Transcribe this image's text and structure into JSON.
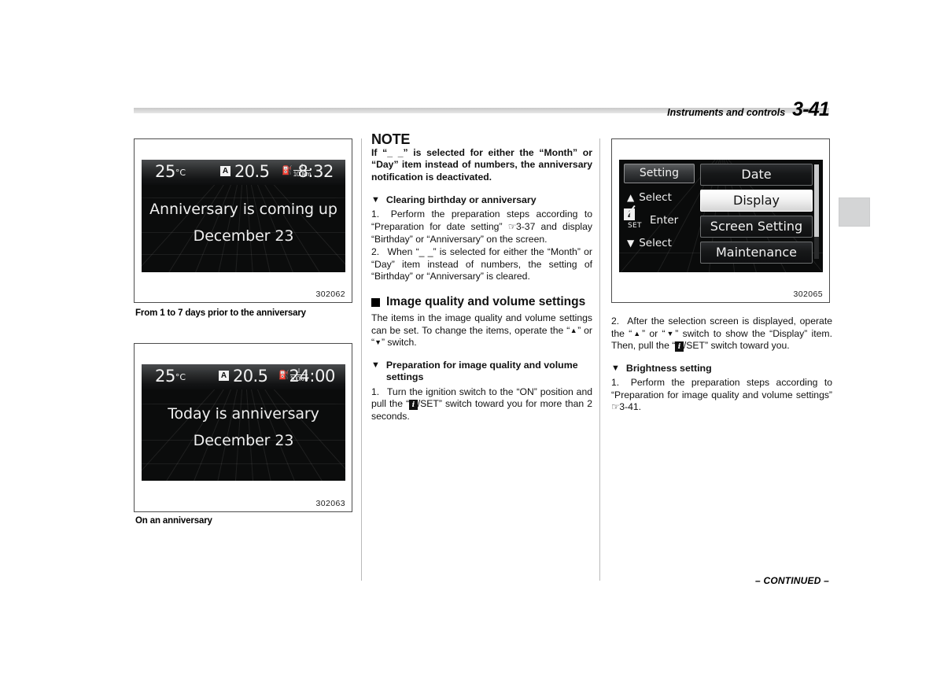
{
  "header": {
    "section_title": "Instruments and controls",
    "page_number": "3-41"
  },
  "footer": {
    "continued": "– CONTINUED –"
  },
  "figures": [
    {
      "id": "302062",
      "caption": "From 1 to 7 days prior to the anniversary",
      "screen": {
        "temperature": "25",
        "temperature_unit": "°C",
        "average_badge": "A",
        "consumption": "20.5",
        "consumption_unit_numerator": "l",
        "consumption_unit_denominator": "100km",
        "fuel_icon": "fuel-pump-icon",
        "time": "8:32",
        "message_line1": "Anniversary is coming up",
        "message_line2": "December 23"
      }
    },
    {
      "id": "302063",
      "caption": "On an anniversary",
      "screen": {
        "temperature": "25",
        "temperature_unit": "°C",
        "average_badge": "A",
        "consumption": "20.5",
        "consumption_unit_numerator": "l",
        "consumption_unit_denominator": "100km",
        "fuel_icon": "fuel-pump-icon",
        "time": "24:00",
        "message_line1": "Today is anniversary",
        "message_line2": "December 23"
      }
    },
    {
      "id": "302065",
      "caption": "",
      "menu_screen": {
        "title_button": "Setting",
        "controls": [
          {
            "icon": "triangle-up-icon",
            "label": "Select"
          },
          {
            "icon": "info-set-icon",
            "label": "Enter"
          },
          {
            "icon": "triangle-down-icon",
            "label": "Select"
          }
        ],
        "iset_icon_letter": "i",
        "iset_icon_sublabel": "SET",
        "items": [
          {
            "label": "Date",
            "selected": false
          },
          {
            "label": "Display",
            "selected": true
          },
          {
            "label": "Screen Setting",
            "selected": false
          },
          {
            "label": "Maintenance",
            "selected": false
          }
        ]
      }
    }
  ],
  "column2": {
    "note_heading": "NOTE",
    "note_body": "If “_ _” is selected for either the “Month” or “Day” item instead of numbers, the anniversary notification is deactivated.",
    "sub1_heading": "Clearing birthday or anniversary",
    "sub1_step1_a": "1.  Perform the preparation steps according to “Preparation for date setting” ",
    "sub1_step1_ref": "3-37",
    "sub1_step1_b": " and display “Birthday” or “Anniversary” on the screen.",
    "sub1_step2": "2.  When “_ _” is selected for either the “Month” or “Day” item instead of numbers, the setting of “Birthday” or “Anniversary” is cleared.",
    "h2_heading": "Image quality and volume settings",
    "h2_body_a": "The items in the image quality and volume settings can be set. To change the items, operate the “",
    "h2_body_b": "” or “",
    "h2_body_c": "” switch.",
    "sub2_heading": "Preparation for image quality and volume settings",
    "sub2_step1_a": "1.  Turn the ignition switch to the “ON” position and pull the “",
    "sub2_step1_badge": "i",
    "sub2_step1_b": "/SET” switch toward you for more than 2 seconds."
  },
  "column3": {
    "step2_a": "2.  After the selection screen is displayed, operate the “",
    "step2_b": "” or “",
    "step2_c": "” switch to show the “Display” item. Then, pull the “",
    "step2_badge": "i",
    "step2_d": "/SET” switch toward you.",
    "sub_heading": "Brightness setting",
    "step1_a": "1.  Perform the preparation steps according to “Preparation for image quality and volume settings” ",
    "step1_ref": "3-41",
    "step1_b": "."
  },
  "icons": {
    "triangle_up": "▲",
    "triangle_down": "▼",
    "hand_pointer": "☞",
    "fuel_pump": "⛽"
  }
}
